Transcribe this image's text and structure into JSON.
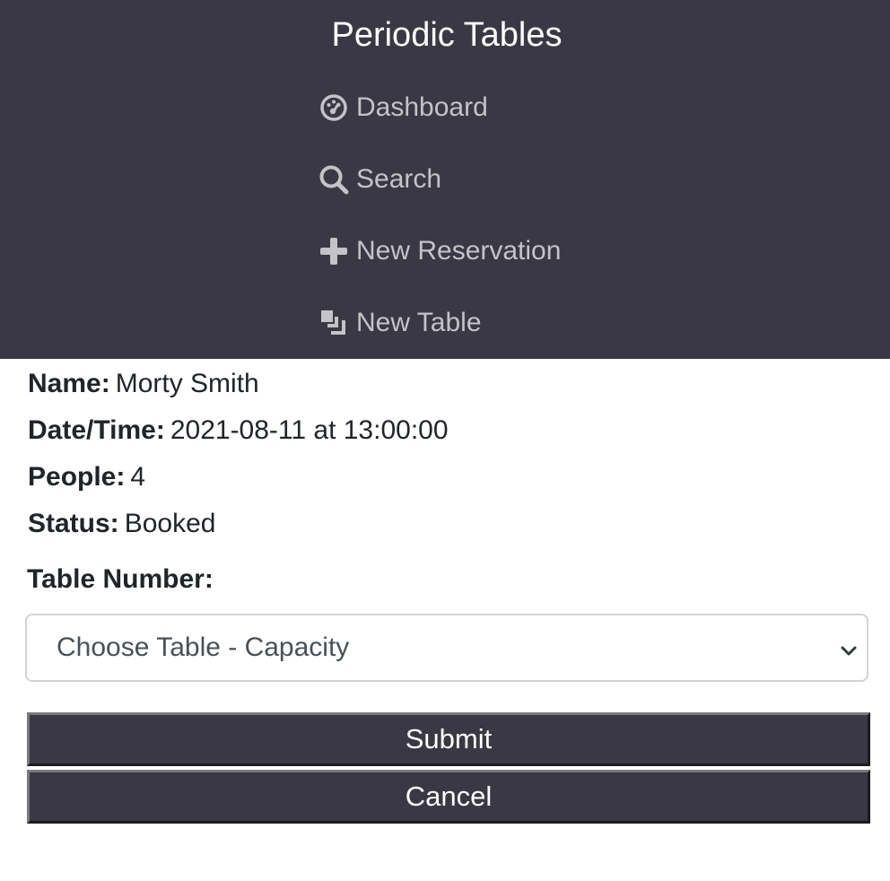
{
  "app": {
    "title": "Periodic Tables"
  },
  "nav": {
    "items": [
      {
        "label": "Dashboard",
        "icon": "dashboard-icon"
      },
      {
        "label": "Search",
        "icon": "search-icon"
      },
      {
        "label": "New Reservation",
        "icon": "plus-icon"
      },
      {
        "label": "New Table",
        "icon": "layers-icon"
      }
    ]
  },
  "reservation": {
    "name_label": "Name:",
    "name": "Morty Smith",
    "datetime_label": "Date/Time:",
    "datetime": "2021-08-11 at 13:00:00",
    "people_label": "People:",
    "people": "4",
    "status_label": "Status:",
    "status": "Booked"
  },
  "form": {
    "table_label": "Table Number:",
    "table_select_value": "Choose Table - Capacity",
    "submit_label": "Submit",
    "cancel_label": "Cancel"
  },
  "colors": {
    "nav_background": "#393844",
    "nav_text": "#c3c3c8",
    "button_background": "#393844",
    "button_text": "#ffffff"
  }
}
